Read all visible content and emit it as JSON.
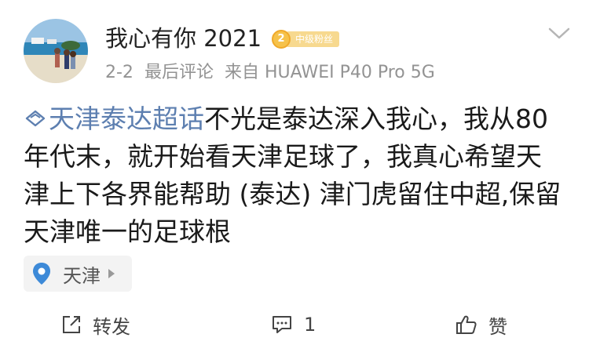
{
  "post": {
    "author": {
      "name": "我心有你 2021",
      "fan_badge": {
        "level": "2",
        "label": "中级粉丝"
      }
    },
    "meta": {
      "date": "2-2",
      "last_comment": "最后评论",
      "source": "来自 HUAWEI P40 Pro 5G"
    },
    "content": {
      "topic": "天津泰达超话",
      "text": "不光是泰达深入我心，我从80年代末，就开始看天津足球了，我真心希望天津上下各界能帮助 (泰达) 津门虎留住中超,保留天津唯一的足球根"
    },
    "location": {
      "label": "天津"
    },
    "actions": {
      "share_label": "转发",
      "comment_count": "1",
      "like_label": "赞"
    }
  },
  "colors": {
    "topic_link": "#5d7fb0",
    "meta_text": "#939393",
    "badge_gold": "#f6c24a"
  },
  "icons": {
    "avatar": "beach-photo-avatar",
    "more": "chevron-down-icon",
    "topic": "diamond-topic-icon",
    "location": "map-pin-icon",
    "share": "share-icon",
    "comment": "comment-icon",
    "like": "thumbs-up-icon"
  }
}
